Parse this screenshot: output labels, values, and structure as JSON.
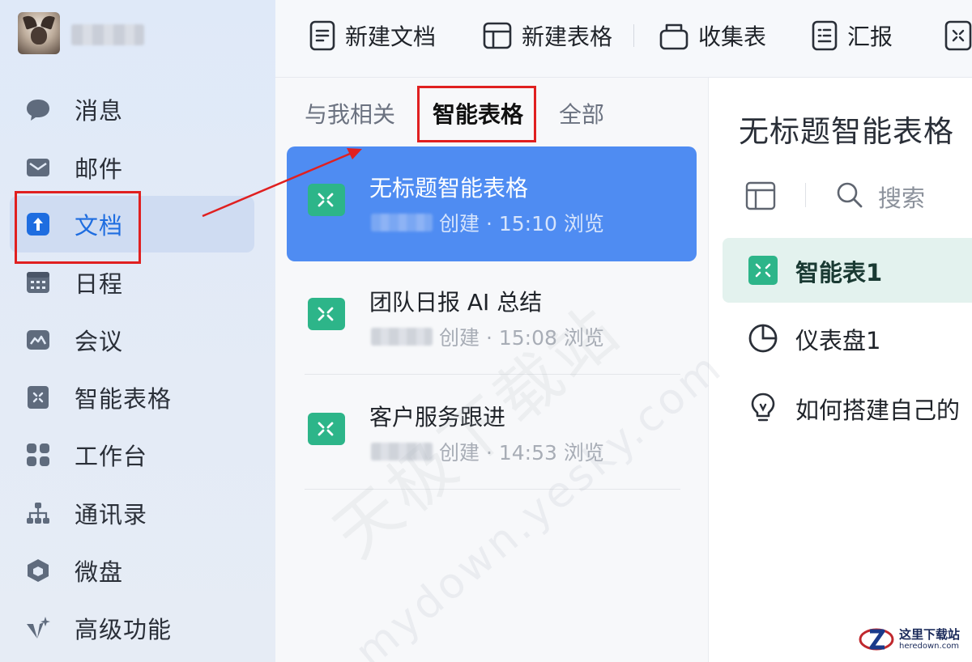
{
  "sidebar": {
    "items": [
      {
        "label": "消息",
        "icon": "chat-bubble-icon"
      },
      {
        "label": "邮件",
        "icon": "mail-icon"
      },
      {
        "label": "文档",
        "icon": "document-icon",
        "active": true
      },
      {
        "label": "日程",
        "icon": "calendar-icon"
      },
      {
        "label": "会议",
        "icon": "meeting-icon"
      },
      {
        "label": "智能表格",
        "icon": "smart-sheet-icon"
      },
      {
        "label": "工作台",
        "icon": "workbench-icon"
      },
      {
        "label": "通讯录",
        "icon": "contacts-icon"
      },
      {
        "label": "微盘",
        "icon": "cloud-drive-icon"
      },
      {
        "label": "高级功能",
        "icon": "sparkle-icon"
      }
    ]
  },
  "toolbar": {
    "new_doc": "新建文档",
    "new_sheet": "新建表格",
    "collect_form": "收集表",
    "report": "汇报"
  },
  "list": {
    "tabs": [
      "与我相关",
      "智能表格",
      "全部"
    ],
    "active_tab": "智能表格",
    "docs": [
      {
        "title": "无标题智能表格",
        "meta": "创建 · 15:10 浏览",
        "selected": true
      },
      {
        "title": "团队日报 AI 总结",
        "meta": "创建 · 15:08 浏览"
      },
      {
        "title": "客户服务跟进",
        "meta": "创建 · 14:53 浏览"
      }
    ]
  },
  "detail": {
    "title": "无标题智能表格",
    "search_label": "搜索",
    "items": [
      {
        "label": "智能表1",
        "icon": "smart-sheet-icon",
        "active": true
      },
      {
        "label": "仪表盘1",
        "icon": "pie-chart-icon"
      },
      {
        "label": "如何搭建自己的",
        "icon": "lightbulb-icon"
      }
    ]
  },
  "watermark": {
    "cn": "天极下载站",
    "en": "mydown.yesky.com",
    "corner_cn": "这里下载站",
    "corner_en": "heredown.com"
  },
  "colors": {
    "accent": "#4f8cf2",
    "sheet_green": "#2db589",
    "highlight": "#e02020"
  }
}
